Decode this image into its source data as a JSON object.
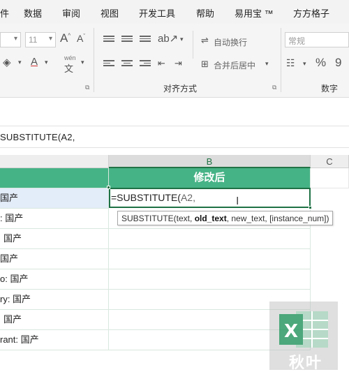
{
  "menu": {
    "items": [
      "件",
      "数据",
      "审阅",
      "视图",
      "开发工具",
      "帮助",
      "易用宝 ™",
      "方方格子"
    ]
  },
  "ribbon": {
    "font_size_value": "11",
    "grow_font_label": "A",
    "shrink_font_label": "A",
    "wen_label": "wén",
    "wrap_text_label": "自动换行",
    "merge_center_label": "合并后居中",
    "number_format_value": "常规",
    "percent_label": "%",
    "comma_label": "9",
    "alignment_group_label": "对齐方式",
    "number_group_label": "数字"
  },
  "formula_bar": {
    "text": "SUBSTITUTE(A2,"
  },
  "grid": {
    "columns": [
      "B",
      "C"
    ],
    "header_cell": "修改后",
    "a_column_cells": [
      " 国产",
      ": 国产",
      " 国产",
      " 国产",
      "o: 国产",
      "ry: 国产",
      " 国产",
      "rant: 国产"
    ],
    "editing_cell": {
      "prefix": "=SUBSTITUTE(",
      "arg": "A2,"
    },
    "tooltip": {
      "func": "SUBSTITUTE(",
      "arg1": "text, ",
      "arg2": "old_text",
      "rest": ", new_text, [instance_num])"
    }
  },
  "watermark": {
    "text": "秋叶",
    "logo_letter": "X"
  },
  "colors": {
    "accent_green": "#217346",
    "header_green": "#46b386"
  }
}
